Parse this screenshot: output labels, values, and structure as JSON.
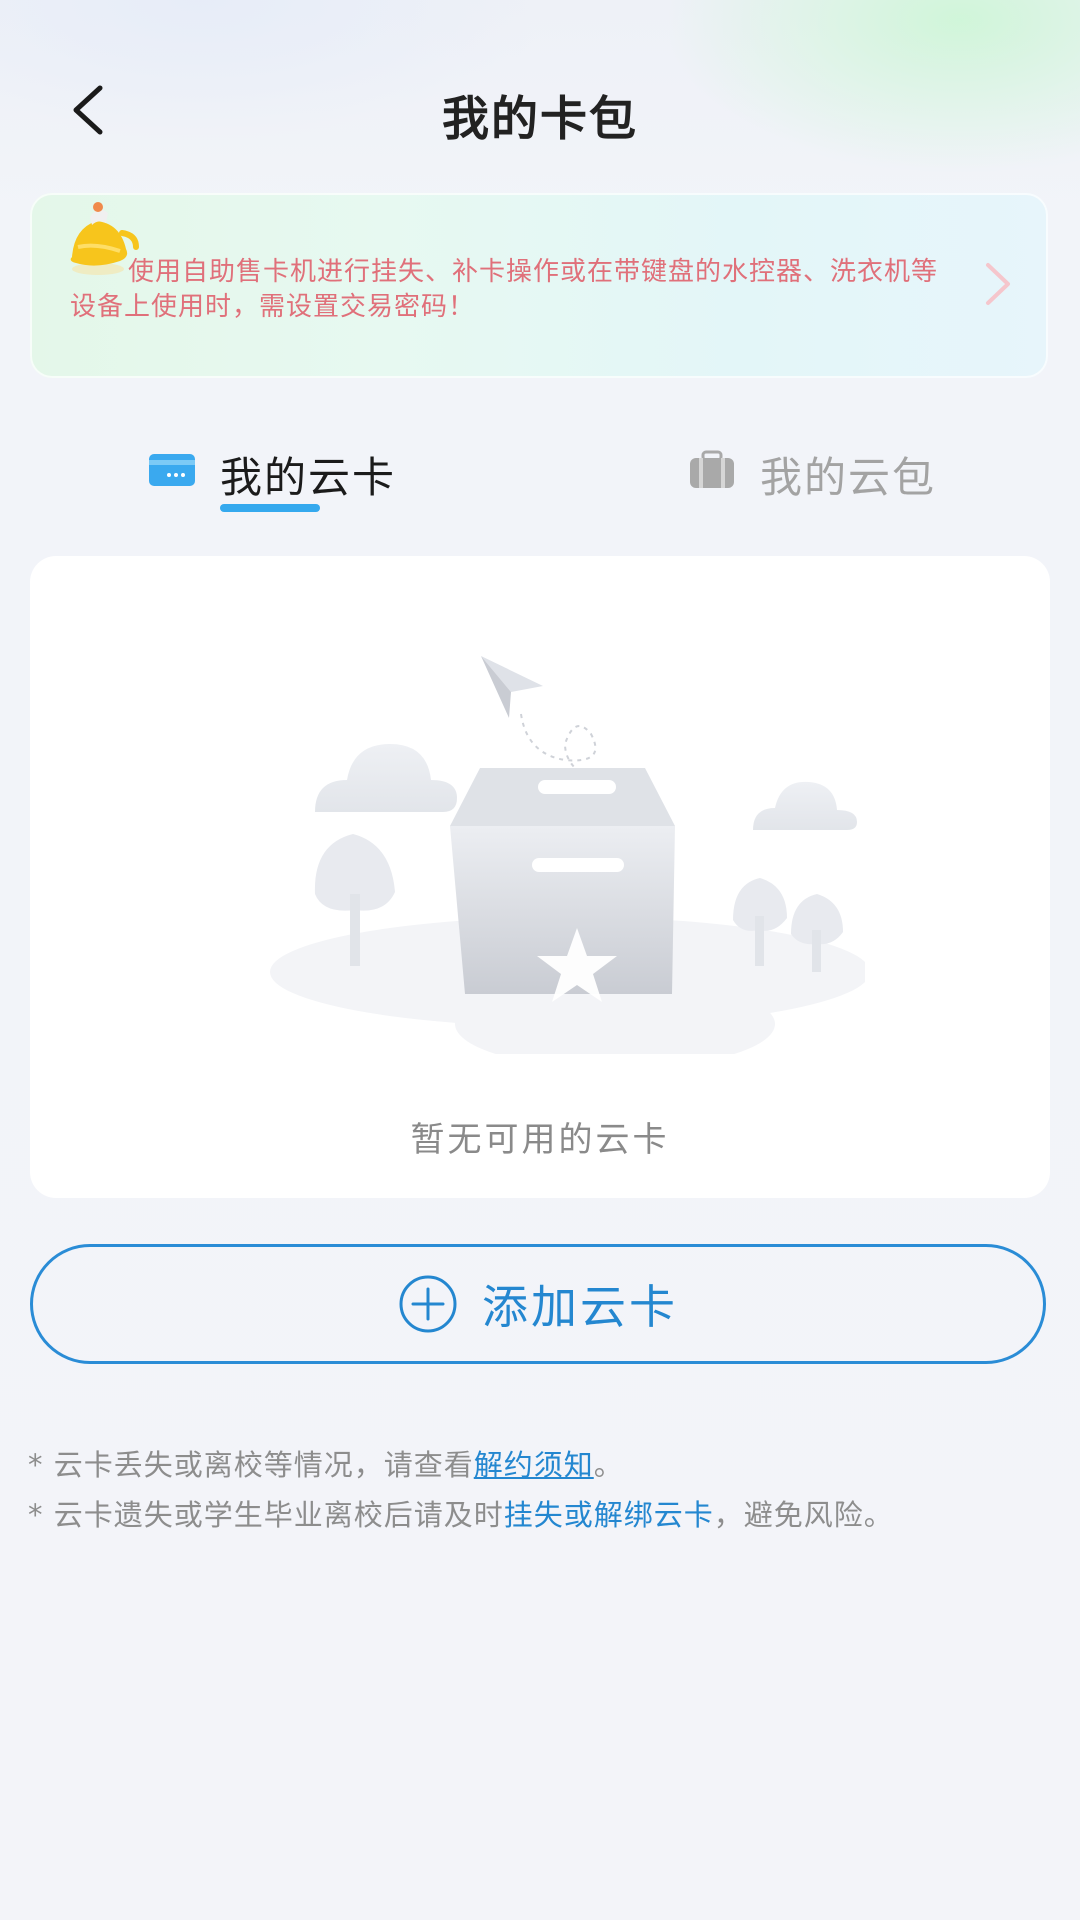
{
  "header": {
    "title": "我的卡包"
  },
  "notice": {
    "text": "使用自助售卡机进行挂失、补卡操作或在带键盘的水控器、洗衣机等设备上使用时，需设置交易密码！"
  },
  "tabs": [
    {
      "label": "我的云卡",
      "icon": "card-icon",
      "active": true
    },
    {
      "label": "我的云包",
      "icon": "wallet-icon",
      "active": false
    }
  ],
  "empty_state": {
    "message": "暂无可用的云卡"
  },
  "add_button": {
    "label": "添加云卡",
    "icon": "plus-circle-icon"
  },
  "notes": {
    "line1_prefix": "* 云卡丢失或离校等情况，请查看",
    "line1_link": "解约须知",
    "line1_suffix": "。",
    "line2_prefix": "* 云卡遗失或学生毕业离校后请及时",
    "line2_link": "挂失或解绑云卡",
    "line2_suffix": "，避免风险。"
  },
  "colors": {
    "accent": "#2487d0",
    "tab_underline": "#35a9ee",
    "notice_text": "#e0707a"
  }
}
